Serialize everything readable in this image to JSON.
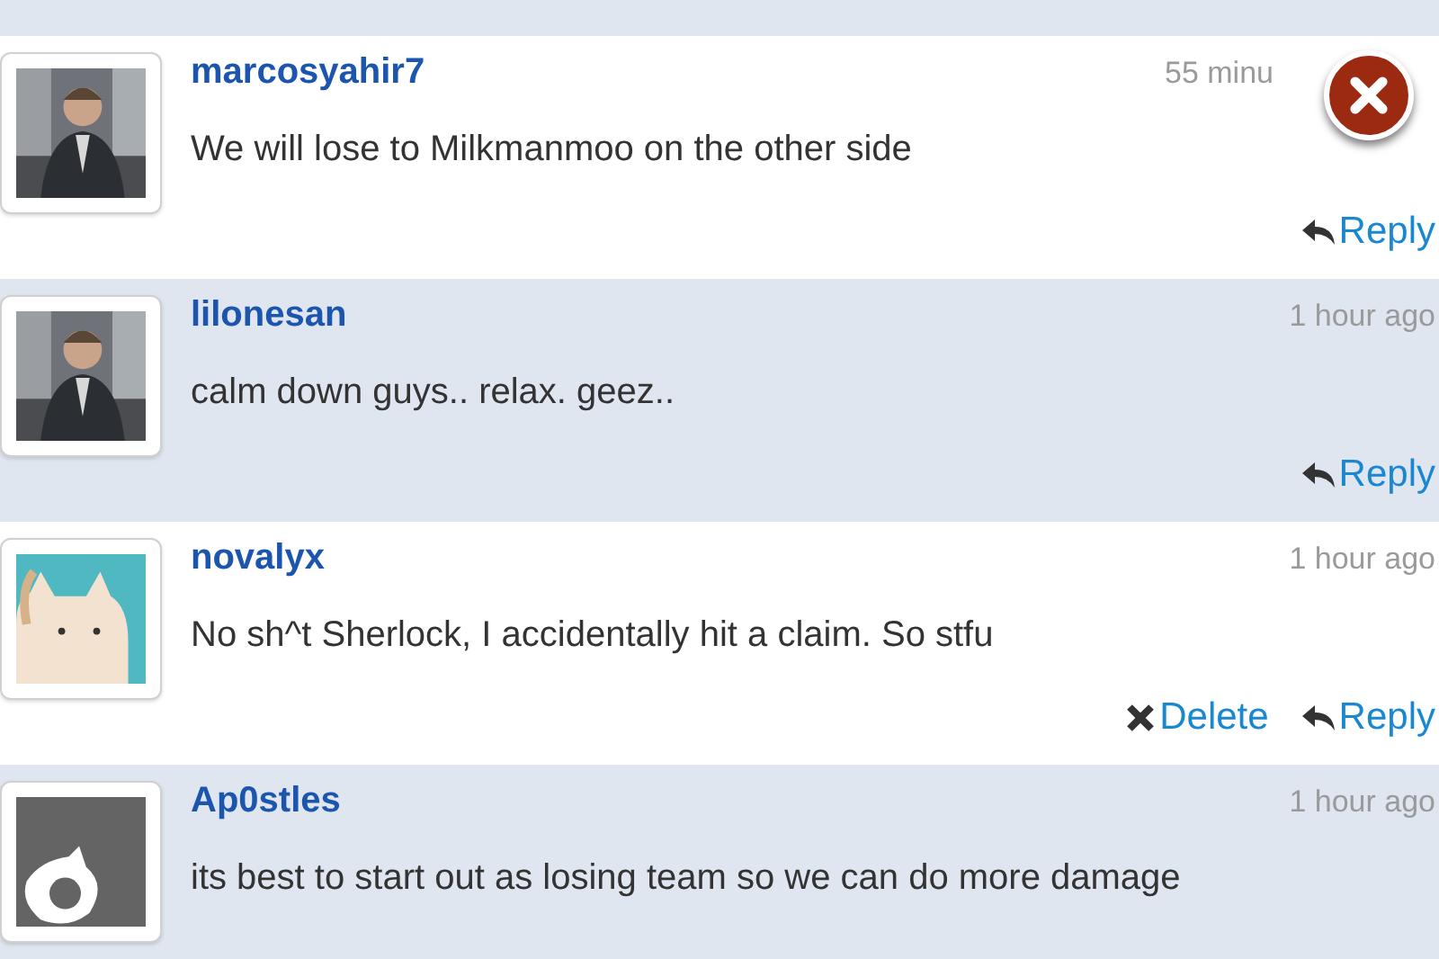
{
  "comments": [
    {
      "user": "marcosyahir7",
      "time": "55 minu",
      "close": true,
      "avatar": {
        "kind": "picture"
      },
      "text": "We will lose to Milkmanmoo on the other side",
      "actions": [
        {
          "kind": "reply",
          "label": "Reply"
        }
      ]
    },
    {
      "user": "lilonesan",
      "time": "1 hour ago",
      "avatar": {
        "kind": "picture"
      },
      "text": "calm down guys.. relax. geez..",
      "actions": [
        {
          "kind": "reply",
          "label": "Reply"
        }
      ]
    },
    {
      "user": "novalyx",
      "time": "1 hour ago",
      "avatar": {
        "kind": "cat"
      },
      "text": "No sh^t Sherlock, I accidentally hit a claim. So stfu",
      "actions": [
        {
          "kind": "delete",
          "label": "Delete"
        },
        {
          "kind": "reply",
          "label": "Reply"
        }
      ]
    },
    {
      "user": "Ap0stles",
      "time": "1 hour ago",
      "avatar": {
        "kind": "moon"
      },
      "text": "its best to start out as losing team so we can do more damage"
    }
  ]
}
